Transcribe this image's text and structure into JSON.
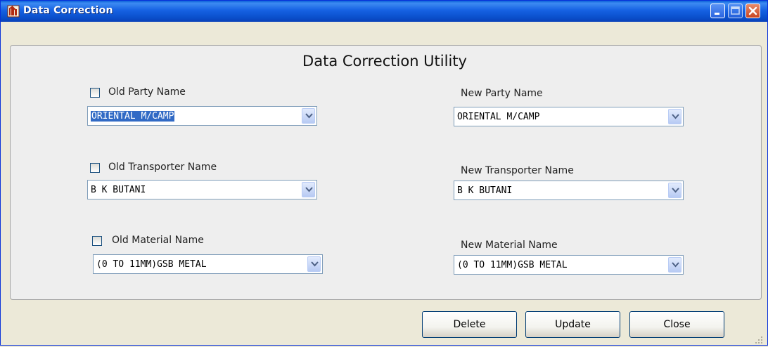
{
  "window": {
    "title": "Data Correction"
  },
  "panel": {
    "title": "Data Correction Utility"
  },
  "old_party": {
    "label": "Old Party Name",
    "value": "ORIENTAL M/CAMP",
    "checked": false
  },
  "new_party": {
    "label": "New Party Name",
    "value": "ORIENTAL M/CAMP"
  },
  "old_transporter": {
    "label": "Old Transporter Name",
    "value": "B K BUTANI",
    "checked": false
  },
  "new_transporter": {
    "label": "New Transporter Name",
    "value": "B K BUTANI"
  },
  "old_material": {
    "label": "Old Material Name",
    "value": "(0 TO 11MM)GSB METAL",
    "checked": false
  },
  "new_material": {
    "label": "New Material Name",
    "value": "(0 TO 11MM)GSB METAL"
  },
  "buttons": {
    "delete": "Delete",
    "update": "Update",
    "close": "Close"
  },
  "icons": {
    "app": "app-logo-icon",
    "minimize": "minimize-icon",
    "maximize": "maximize-icon",
    "close": "close-icon",
    "dropdown": "chevron-down-icon",
    "resize": "resize-grip-icon"
  },
  "colors": {
    "titlebar": "#0A4FCB",
    "selection": "#316AC5",
    "window_bg": "#ECE9D8"
  }
}
